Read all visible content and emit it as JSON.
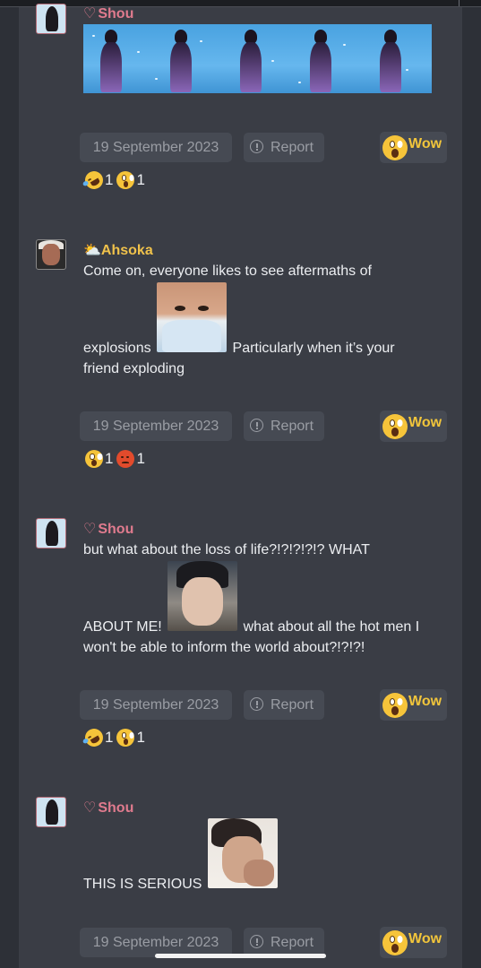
{
  "comments": [
    {
      "author": "Shou",
      "heart": "♡",
      "date": "19 September 2023",
      "report": "Report",
      "wow": "Wow",
      "reactions": [
        {
          "emoji": "rofl",
          "count": "1"
        },
        {
          "emoji": "astonished",
          "count": "1"
        }
      ]
    },
    {
      "author": "Ahsoka",
      "author_emoji": "⛅",
      "text_1": "Come on, everyone likes to see aftermaths of",
      "text_2": "explosions",
      "text_3": "Particularly when it’s your",
      "text_4": "friend exploding",
      "date": "19 September 2023",
      "report": "Report",
      "wow": "Wow",
      "reactions": [
        {
          "emoji": "astonished",
          "count": "1"
        },
        {
          "emoji": "angry",
          "count": "1"
        }
      ]
    },
    {
      "author": "Shou",
      "heart": "♡",
      "text_1": "but what about the loss of life?!?!?!?!? WHAT",
      "text_2": "ABOUT ME!",
      "text_3": "what about all the hot men I",
      "text_4": "won't be able to inform the world about?!?!?!",
      "date": "19 September 2023",
      "report": "Report",
      "wow": "Wow",
      "reactions": [
        {
          "emoji": "rofl",
          "count": "1"
        },
        {
          "emoji": "astonished",
          "count": "1"
        }
      ]
    },
    {
      "author": "Shou",
      "heart": "♡",
      "text_1": "THIS IS SERIOUS",
      "date": "19 September 2023",
      "report": "Report",
      "wow": "Wow"
    }
  ],
  "colors": {
    "background": "#2d3037",
    "panel": "#3a3d45",
    "pill": "#464a53",
    "name_pink": "#e07b8e",
    "name_gold": "#f0c24b",
    "wow_gold": "#f1c53b"
  }
}
